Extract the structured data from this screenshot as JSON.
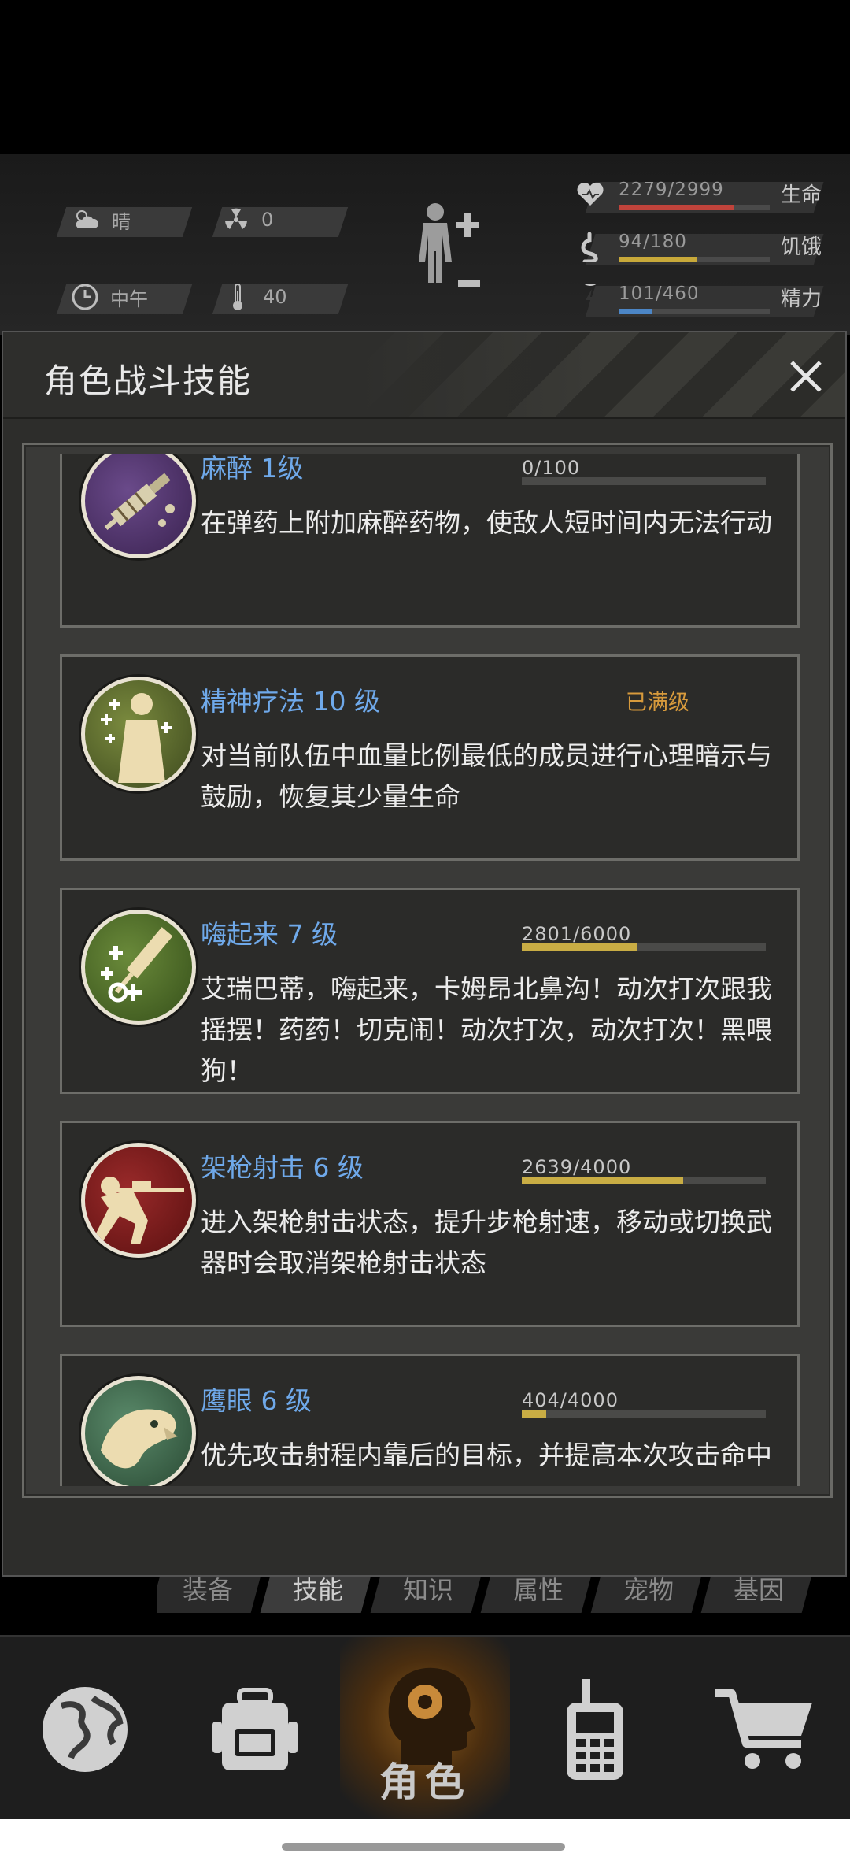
{
  "hud": {
    "weather": {
      "icon": "cloudy-icon",
      "value": "晴"
    },
    "radiation": {
      "icon": "radiation-icon",
      "value": "0"
    },
    "time": {
      "icon": "clock-icon",
      "value": "中午"
    },
    "temperature": {
      "icon": "thermometer-icon",
      "value": "40"
    },
    "stats": [
      {
        "icon": "heart-icon",
        "value": "2279/2999",
        "label": "生命",
        "fraction": 0.76,
        "color": "#c0433b"
      },
      {
        "icon": "stomach-icon",
        "value": "94/180",
        "label": "饥饿",
        "fraction": 0.52,
        "color": "#c8a93a"
      },
      {
        "icon": "energy-icon",
        "value": "101/460",
        "label": "精力",
        "fraction": 0.22,
        "color": "#4c86c6"
      }
    ]
  },
  "modal": {
    "title": "角色战斗技能",
    "close_icon": "close-icon",
    "skills": [
      {
        "name": "麻醉 1级",
        "progress_text": "0/100",
        "fraction": 0.0,
        "maxed_text": "",
        "desc": "在弹药上附加麻醉药物，使敌人短时间内无法行动",
        "icon": "syringe-icon",
        "icon_bg": "#4a2f63"
      },
      {
        "name": "精神疗法 10 级",
        "progress_text": "",
        "fraction": 1.0,
        "maxed_text": "已满级",
        "desc": "对当前队伍中血量比例最低的成员进行心理暗示与鼓励，恢复其少量生命",
        "icon": "psychotherapy-icon",
        "icon_bg": "#56652e"
      },
      {
        "name": "嗨起来 7 级",
        "progress_text": "2801/6000",
        "fraction": 0.47,
        "maxed_text": "",
        "desc": "艾瑞巴蒂，嗨起来，卡姆昂北鼻沟！动次打次跟我摇摆！药药！切克闹！动次打次，动次打次！黑喂狗！",
        "icon": "hype-icon",
        "icon_bg": "#4d6a2c"
      },
      {
        "name": "架枪射击 6 级",
        "progress_text": "2639/4000",
        "fraction": 0.66,
        "maxed_text": "",
        "desc": "进入架枪射击状态，提升步枪射速，移动或切换武器时会取消架枪射击状态",
        "icon": "sniper-icon",
        "icon_bg": "#7a1f1f"
      },
      {
        "name": "鹰眼 6 级",
        "progress_text": "404/4000",
        "fraction": 0.1,
        "maxed_text": "",
        "desc": "优先攻击射程内靠后的目标，并提高本次攻击命中",
        "icon": "eagle-eye-icon",
        "icon_bg": "#3f6a4a"
      }
    ]
  },
  "subtabs": [
    {
      "label": "装备",
      "active": false
    },
    {
      "label": "技能",
      "active": true
    },
    {
      "label": "知识",
      "active": false
    },
    {
      "label": "属性",
      "active": false
    },
    {
      "label": "宠物",
      "active": false
    },
    {
      "label": "基因",
      "active": false
    }
  ],
  "nav": [
    {
      "icon": "globe-icon",
      "label": ""
    },
    {
      "icon": "backpack-icon",
      "label": ""
    },
    {
      "icon": "character-head-icon",
      "label": "角色",
      "active": true
    },
    {
      "icon": "radio-icon",
      "label": ""
    },
    {
      "icon": "cart-icon",
      "label": ""
    }
  ]
}
